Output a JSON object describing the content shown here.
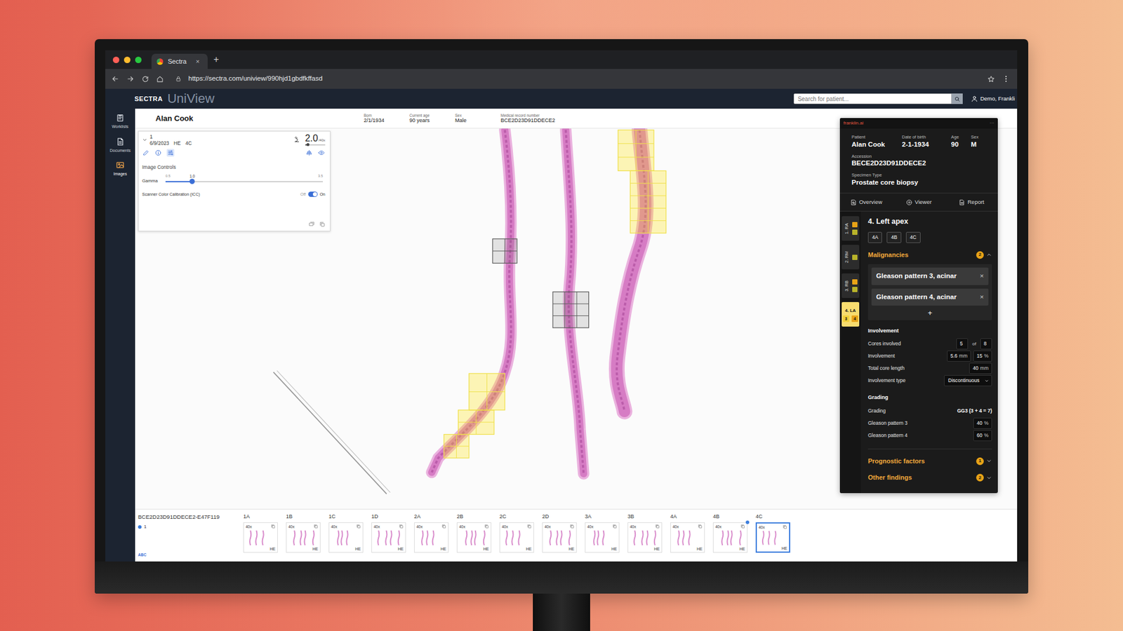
{
  "browser": {
    "tab_title": "Sectra",
    "tab_close": "×",
    "new_tab": "+",
    "url": "https://sectra.com/uniview/990hjd1gbdfkffasd"
  },
  "app": {
    "brand": "SECTRA",
    "product": "UniView",
    "search": {
      "placeholder": "Search for patient..."
    },
    "user": "Demo, Frankli"
  },
  "sidebar": {
    "items": [
      {
        "label": "Worklists",
        "selected": false
      },
      {
        "label": "Documents",
        "selected": false
      },
      {
        "label": "Images",
        "selected": true
      }
    ]
  },
  "patient_header": {
    "name": "Alan Cook",
    "fields": [
      {
        "label": "Born",
        "value": "2/1/1934"
      },
      {
        "label": "Current age",
        "value": "90 years"
      },
      {
        "label": "Sex",
        "value": "Male"
      },
      {
        "label": "Medical record number",
        "value": "BCE2D23D91DDECE2"
      }
    ]
  },
  "image_panel": {
    "case": "1",
    "date": "6/9/2023",
    "stain": "HE",
    "block": "4C",
    "zoom": "2.0",
    "zoom_unit": "/40x",
    "zoom_level": 0.12,
    "title": "Image Controls",
    "gamma": {
      "label": "Gamma",
      "min": "0.5",
      "max": "3.5",
      "value": "1.0",
      "level": 0.17
    },
    "icc": {
      "label": "Scanner Color Calibration (ICC)",
      "off_label": "Off",
      "on_label": "On",
      "on": true
    }
  },
  "viewer": {
    "case_id": "BCE2D23D91DDECE2-E47F119",
    "case": "1",
    "annotation_tool": "ABC",
    "thumbnails": [
      {
        "label": "1A",
        "magnification": "40x",
        "stain": "HE",
        "selected": false,
        "dot": false
      },
      {
        "label": "1B",
        "magnification": "40x",
        "stain": "HE",
        "selected": false,
        "dot": false
      },
      {
        "label": "1C",
        "magnification": "40x",
        "stain": "HE",
        "selected": false,
        "dot": false
      },
      {
        "label": "1D",
        "magnification": "40x",
        "stain": "HE",
        "selected": false,
        "dot": false
      },
      {
        "label": "2A",
        "magnification": "40x",
        "stain": "HE",
        "selected": false,
        "dot": false
      },
      {
        "label": "2B",
        "magnification": "40x",
        "stain": "HE",
        "selected": false,
        "dot": false
      },
      {
        "label": "2C",
        "magnification": "40x",
        "stain": "HE",
        "selected": false,
        "dot": false
      },
      {
        "label": "2D",
        "magnification": "40x",
        "stain": "HE",
        "selected": false,
        "dot": false
      },
      {
        "label": "3A",
        "magnification": "40x",
        "stain": "HE",
        "selected": false,
        "dot": false
      },
      {
        "label": "3B",
        "magnification": "40x",
        "stain": "HE",
        "selected": false,
        "dot": false
      },
      {
        "label": "4A",
        "magnification": "40x",
        "stain": "HE",
        "selected": false,
        "dot": false
      },
      {
        "label": "4B",
        "magnification": "40x",
        "stain": "HE",
        "selected": false,
        "dot": true
      },
      {
        "label": "4C",
        "magnification": "40x",
        "stain": "HE",
        "selected": true,
        "dot": false
      }
    ]
  },
  "franklin": {
    "brand": "franklin.ai",
    "menu": "···",
    "patient": [
      {
        "label": "Patient",
        "value": "Alan Cook"
      },
      {
        "label": "Date of birth",
        "value": "2-1-1934"
      },
      {
        "label": "Age",
        "value": "90"
      },
      {
        "label": "Sex",
        "value": "M"
      }
    ],
    "accession": {
      "label": "Accession",
      "value": "BECE2D23D91DDECE2"
    },
    "specimen": {
      "label": "Specimen Type",
      "value": "Prostate core biopsy"
    },
    "tabs": [
      {
        "label": "Overview",
        "selected": false
      },
      {
        "label": "Viewer",
        "selected": false
      },
      {
        "label": "Report",
        "selected": false
      }
    ],
    "sites": [
      {
        "label": "1. RA",
        "selected": false,
        "badges": [
          {
            "color": "#e8a317"
          },
          {
            "color": "#b8b32a"
          }
        ]
      },
      {
        "label": "2. RM",
        "selected": false,
        "badges": [
          {
            "color": "#b8b32a"
          }
        ]
      },
      {
        "label": "3. RB",
        "selected": false,
        "badges": [
          {
            "color": "#e8a317"
          },
          {
            "color": "#b8b32a"
          }
        ]
      },
      {
        "label": "4. LA",
        "selected": true,
        "badges": [
          {
            "text": "3",
            "color": "#f2d03b"
          },
          {
            "text": "4",
            "color": "#e8a317"
          }
        ]
      }
    ],
    "site_title": "4. Left apex",
    "cores": [
      {
        "label": "4A",
        "selected": false
      },
      {
        "label": "4B",
        "selected": false
      },
      {
        "label": "4C",
        "selected": false
      }
    ],
    "malignancies": {
      "title": "Malignancies",
      "count": "2",
      "expanded": true,
      "tags": [
        {
          "label": "Gleason pattern 3, acinar",
          "remove": "×"
        },
        {
          "label": "Gleason pattern 4, acinar",
          "remove": "×"
        }
      ],
      "add": "+"
    },
    "involvement": {
      "title": "Involvement",
      "rows": [
        {
          "label": "Cores involved",
          "kind": "pair",
          "joiner": "of",
          "fields": [
            {
              "value": "5"
            },
            {
              "value": "8"
            }
          ]
        },
        {
          "label": "Involvement",
          "kind": "pair",
          "fields": [
            {
              "value": "5.6",
              "unit": "mm"
            },
            {
              "value": "15",
              "unit": "%"
            }
          ]
        },
        {
          "label": "Total core length",
          "kind": "pair",
          "fields": [
            {
              "value": "40",
              "unit": "mm"
            }
          ]
        },
        {
          "label": "Involvement type",
          "kind": "select",
          "value": "Discontinuous"
        }
      ]
    },
    "grading": {
      "title": "Grading",
      "rows": [
        {
          "label": "Grading",
          "kind": "text",
          "value": "GG3 (3 + 4 = 7)"
        },
        {
          "label": "Gleason pattern 3",
          "kind": "pair",
          "fields": [
            {
              "value": "40",
              "unit": "%"
            }
          ]
        },
        {
          "label": "Gleason pattern 4",
          "kind": "pair",
          "fields": [
            {
              "value": "60",
              "unit": "%"
            }
          ]
        }
      ]
    },
    "sections": [
      {
        "title": "Prognostic factors",
        "count": "1",
        "expanded": false
      },
      {
        "title": "Other findings",
        "count": "2",
        "expanded": false
      }
    ]
  }
}
